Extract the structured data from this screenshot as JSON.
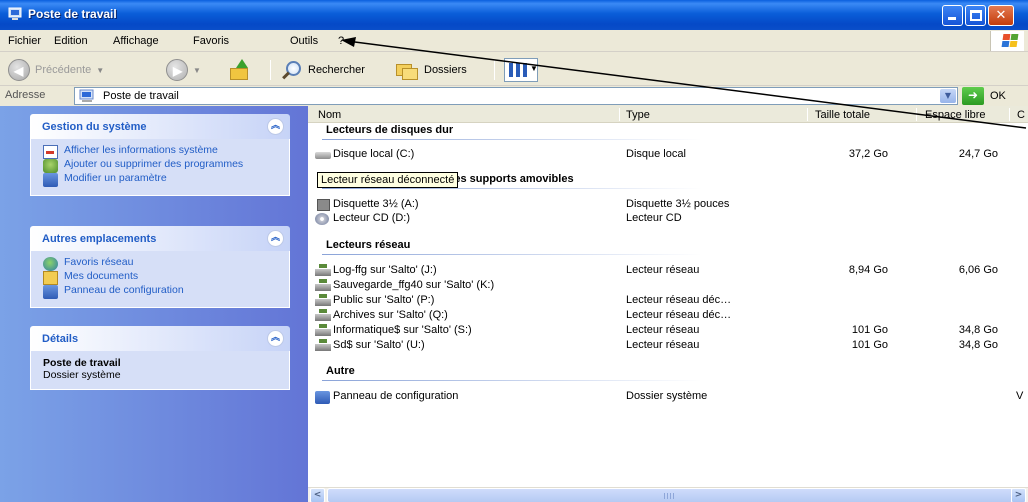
{
  "window": {
    "title": "Poste de travail",
    "controls": [
      "minimize-icon",
      "maximize-icon",
      "close-icon"
    ]
  },
  "menu": {
    "items": [
      {
        "label": "Fichier"
      },
      {
        "label": "Edition"
      },
      {
        "label": "Affichage"
      },
      {
        "label": "Favoris"
      },
      {
        "label": "Outils"
      },
      {
        "label": "?"
      }
    ]
  },
  "toolbar": {
    "back_label": "Précédente",
    "search_label": "Rechercher",
    "folders_label": "Dossiers",
    "icons": [
      "back-icon",
      "forward-icon",
      "folder-up-icon",
      "search-icon",
      "folders-icon",
      "views-icon"
    ]
  },
  "address": {
    "label": "Adresse",
    "value": "Poste de travail",
    "go_label": "OK"
  },
  "sidebar": {
    "panels": [
      {
        "title": "Gestion du système",
        "items": [
          {
            "label": "Afficher les informations système",
            "icon": "system-info-icon"
          },
          {
            "label": "Ajouter ou supprimer des programmes",
            "icon": "add-remove-icon"
          },
          {
            "label": "Modifier un paramètre",
            "icon": "control-panel-icon"
          }
        ]
      },
      {
        "title": "Autres emplacements",
        "items": [
          {
            "label": "Favoris réseau",
            "icon": "network-places-icon"
          },
          {
            "label": "Mes documents",
            "icon": "my-documents-icon"
          },
          {
            "label": "Panneau de configuration",
            "icon": "control-panel-icon"
          }
        ]
      },
      {
        "title": "Détails",
        "detail_title": "Poste de travail",
        "detail_sub": "Dossier système"
      }
    ]
  },
  "columns": [
    "Nom",
    "Type",
    "Taille totale",
    "Espace libre",
    "C"
  ],
  "groups": [
    {
      "title": "Lecteurs de disques dur",
      "rows": [
        {
          "name": "Disque local (C:)",
          "type": "Disque local",
          "total": "37,2 Go",
          "free": "24,7 Go",
          "icon": "hard-disk-icon"
        }
      ]
    },
    {
      "title": "Périphériques utilisant des supports amovibles",
      "rows": [
        {
          "name": "Disquette 3½ (A:)",
          "type": "Disquette 3½ pouces",
          "total": "",
          "free": "",
          "icon": "floppy-icon"
        },
        {
          "name": "Lecteur CD (D:)",
          "type": "Lecteur CD",
          "total": "",
          "free": "",
          "icon": "cd-drive-icon"
        }
      ]
    },
    {
      "title": "Lecteurs réseau",
      "rows": [
        {
          "name": "Log-ffg sur 'Salto' (J:)",
          "type": "Lecteur réseau",
          "total": "8,94 Go",
          "free": "6,06 Go",
          "icon": "network-drive-icon"
        },
        {
          "name": "Sauvegarde_ffg40 sur 'Salto' (K:)",
          "type": "",
          "total": "",
          "free": "",
          "icon": "network-drive-icon"
        },
        {
          "name": "Public sur 'Salto' (P:)",
          "type": "Lecteur réseau déc…",
          "total": "",
          "free": "",
          "icon": "network-drive-icon"
        },
        {
          "name": "Archives sur 'Salto' (Q:)",
          "type": "Lecteur réseau déc…",
          "total": "",
          "free": "",
          "icon": "network-drive-icon"
        },
        {
          "name": "Informatique$ sur 'Salto' (S:)",
          "type": "Lecteur réseau",
          "total": "101 Go",
          "free": "34,8 Go",
          "icon": "network-drive-icon"
        },
        {
          "name": "Sd$ sur 'Salto' (U:)",
          "type": "Lecteur réseau",
          "total": "101 Go",
          "free": "34,8 Go",
          "icon": "network-drive-icon"
        }
      ]
    },
    {
      "title": "Autre",
      "rows": [
        {
          "name": "Panneau de configuration",
          "type": "Dossier système",
          "total": "",
          "free": "",
          "extra": "V",
          "icon": "control-panel-icon"
        }
      ]
    }
  ],
  "tooltip": "Lecteur réseau déconnecté",
  "scrollbar": {
    "left": "<",
    "right": ">"
  }
}
